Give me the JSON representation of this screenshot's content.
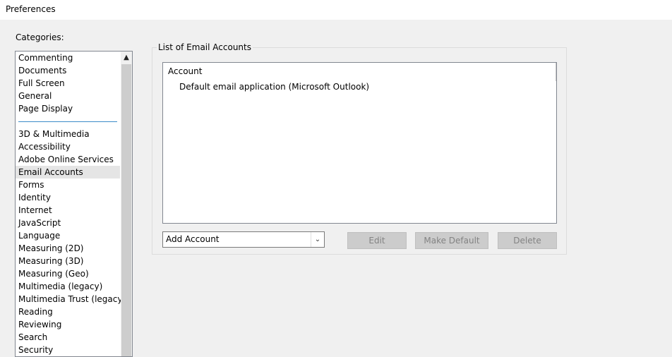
{
  "window": {
    "title": "Preferences"
  },
  "categories": {
    "label": "Categories:",
    "group_top": [
      "Commenting",
      "Documents",
      "Full Screen",
      "General",
      "Page Display"
    ],
    "group_bottom": [
      "3D & Multimedia",
      "Accessibility",
      "Adobe Online Services",
      "Email Accounts",
      "Forms",
      "Identity",
      "Internet",
      "JavaScript",
      "Language",
      "Measuring (2D)",
      "Measuring (3D)",
      "Measuring (Geo)",
      "Multimedia (legacy)",
      "Multimedia Trust (legacy)",
      "Reading",
      "Reviewing",
      "Search",
      "Security"
    ],
    "selected": "Email Accounts",
    "scroll_up_icon": "chevron-up-icon"
  },
  "email_accounts": {
    "group_title": "List of Email Accounts",
    "list_header": "Account",
    "accounts": [
      "Default email application (Microsoft Outlook)"
    ],
    "add_account": {
      "value": "Add Account",
      "arrow_icon": "chevron-down-icon"
    },
    "buttons": {
      "edit": "Edit",
      "make_default": "Make Default",
      "delete": "Delete"
    }
  },
  "colors": {
    "selection": "#e5e5e5",
    "separator": "#3c8cc8",
    "disabled_button": "#cccccc"
  }
}
